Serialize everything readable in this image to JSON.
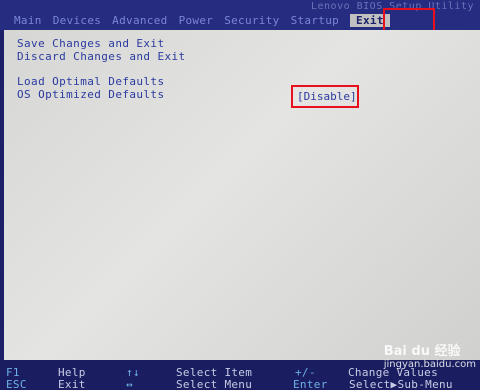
{
  "header": {
    "bios_title": "Lenovo BIOS Setup Utility",
    "tabs": [
      "Main",
      "Devices",
      "Advanced",
      "Power",
      "Security",
      "Startup",
      "Exit"
    ],
    "active_tab": "Exit"
  },
  "menu": {
    "items": [
      "Save Changes and Exit",
      "Discard Changes and Exit",
      "Load Optimal Defaults",
      "OS Optimized Defaults"
    ],
    "os_optimized_value": "[Disable]"
  },
  "footer": {
    "row1": {
      "key1": "F1",
      "desc1": "Help",
      "key2": "↑↓",
      "desc2": "Select Item",
      "key3": "+/-",
      "desc3": "Change Values"
    },
    "row2": {
      "key1": "ESC",
      "desc1": "Exit",
      "key2": "↔",
      "desc2": "Select Menu",
      "key3": "Enter",
      "desc3": "Select▶Sub-Menu"
    }
  },
  "watermark": {
    "brand": "Bai du 经验",
    "url": "jingyan.baidu.com"
  },
  "colors": {
    "background": "#1c2068",
    "panel": "#dcdcda",
    "menu_text": "#2a3aa0",
    "highlight": "#e8101c"
  }
}
